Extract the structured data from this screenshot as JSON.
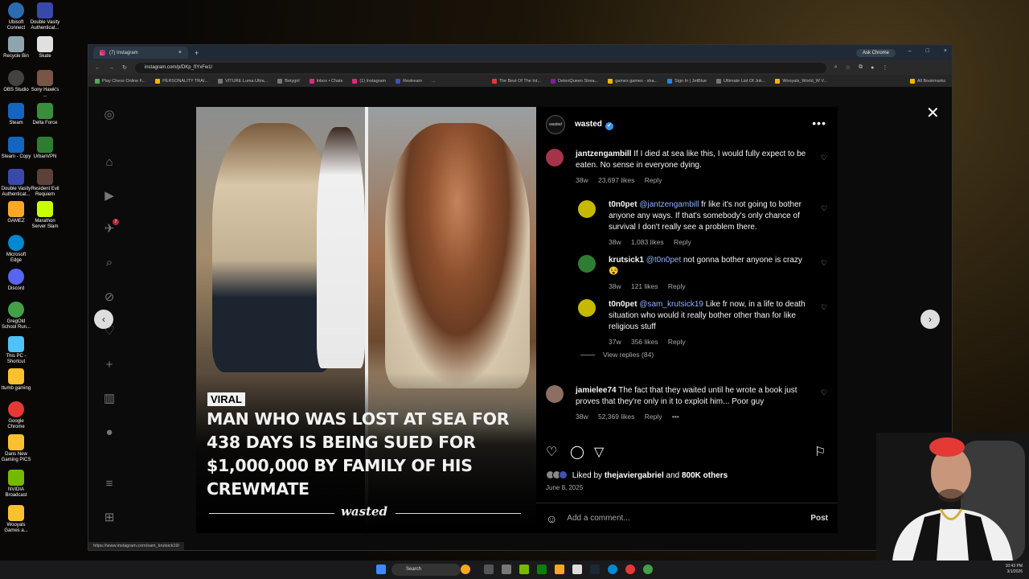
{
  "desktop": {
    "icons": [
      "Ubisoft Connect",
      "Double Vasity Authenticat...",
      "Recycle Bin",
      "Skate",
      "OBS Studio",
      "Sony Hawk's ...",
      "Steam",
      "Delta Force",
      "Steam - Copy",
      "UrbanVPN",
      "Double Vasity Authenticat...",
      "Resident Evil Requiem",
      "GAMEZ",
      "Marathon Server Slam",
      "Microsoft Edge",
      "Discord",
      "GregOld School Run...",
      "This PC - Shortcut",
      "ttumb gaming",
      "Google Chrome",
      "Dans New Gaming PICS",
      "NVIDIA Broadcast",
      "Wooyals Games a..."
    ]
  },
  "browser": {
    "tab_title": "(7) Instagram",
    "tab_close": "×",
    "new_tab": "+",
    "ask_chrome": "Ask Chrome",
    "window_controls": [
      "–",
      "□",
      "×"
    ],
    "url": "instagram.com/p/DKp_fIYxFw1/",
    "bookmarks": [
      "Play Chess Online F...",
      "PERSONALITY TRAI...",
      "VITURE Luma Ultra...",
      "Betygirl",
      "Inbox • Chats",
      "(1) Instagram",
      "Restream",
      "...",
      "The Best Of The Int...",
      "DelenQueen Strea...",
      "games games - sha...",
      "Sign In | JetBlue",
      "Ultimate List Of Jok...",
      "Wooyals_World_W V...",
      "All Bookmarks"
    ],
    "status_url": "https://www.instagram.com/sam_krutsick19/"
  },
  "instagram": {
    "sidebar_badge": "7",
    "media": {
      "tag": "VIRAL",
      "headline": "MAN WHO WAS LOST AT SEA FOR 438 DAYS IS BEING SUED FOR $1,000,000 BY FAMILY OF HIS CREWMATE",
      "brand": "wasted"
    },
    "post": {
      "avatar_text": "wasted",
      "username": "wasted",
      "more": "•••",
      "comments": [
        {
          "user": "jantzengambill",
          "mention": "",
          "text": "If I died at sea like this, I would fully expect to be eaten. No sense in everyone dying.",
          "age": "38w",
          "likes": "23,697 likes",
          "reply": "Reply"
        },
        {
          "user": "t0n0pet",
          "mention": "@jantzengambill",
          "text": "fr like it's not going to bother anyone any ways. If that's somebody's only chance of survival I don't really see a problem there.",
          "age": "38w",
          "likes": "1,083 likes",
          "reply": "Reply"
        },
        {
          "user": "krutsick1",
          "mention": "@t0n0pet",
          "text": "not gonna bother anyone is crazy 😵",
          "age": "38w",
          "likes": "121 likes",
          "reply": "Reply"
        },
        {
          "user": "t0n0pet",
          "mention": "@sam_krutsick19",
          "text": "Like fr now, in a life to death situation who would it really bother other than for like religious stuff",
          "age": "37w",
          "likes": "356 likes",
          "reply": "Reply"
        },
        {
          "user": "jamielee74",
          "mention": "",
          "text": "The fact that they waited until he wrote a book just proves that they're only in it to exploit him... Poor guy",
          "age": "38w",
          "likes": "52,369 likes",
          "reply": "Reply"
        }
      ],
      "view_replies": "View replies (84)",
      "liked_by_prefix": "Liked by",
      "liked_by_user": "thejaviergabriel",
      "liked_by_suffix": "and",
      "liked_by_count": "800K others",
      "date": "June 8, 2025",
      "add_comment_placeholder": "Add a comment...",
      "post_button": "Post"
    }
  },
  "taskbar": {
    "search_label": "Search",
    "time": "10:43 PM",
    "date": "3/1/2026"
  }
}
